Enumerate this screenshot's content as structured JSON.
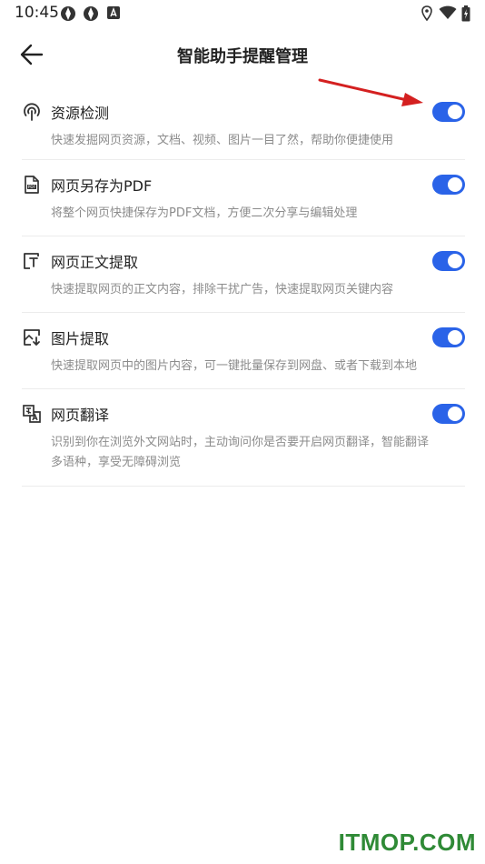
{
  "status": {
    "time": "10:45"
  },
  "header": {
    "title": "智能助手提醒管理"
  },
  "items": [
    {
      "title": "资源检测",
      "desc": "快速发掘网页资源，文档、视频、图片一目了然，帮助你便捷使用",
      "enabled": true,
      "icon": "resource-detect-icon"
    },
    {
      "title": "网页另存为PDF",
      "desc": "将整个网页快捷保存为PDF文档，方便二次分享与编辑处理",
      "enabled": true,
      "icon": "pdf-icon"
    },
    {
      "title": "网页正文提取",
      "desc": "快速提取网页的正文内容，排除干扰广告，快速提取网页关键内容",
      "enabled": true,
      "icon": "text-extract-icon"
    },
    {
      "title": "图片提取",
      "desc": "快速提取网页中的图片内容，可一键批量保存到网盘、或者下载到本地",
      "enabled": true,
      "icon": "image-extract-icon"
    },
    {
      "title": "网页翻译",
      "desc": "识别到你在浏览外文网站时，主动询问你是否要开启网页翻译，智能翻译多语种，享受无障碍浏览",
      "enabled": true,
      "icon": "translate-icon"
    }
  ],
  "watermark": "ITMOP.COM",
  "colors": {
    "toggle_on": "#2a63e8",
    "arrow": "#d42020",
    "watermark": "#2f8a36"
  }
}
